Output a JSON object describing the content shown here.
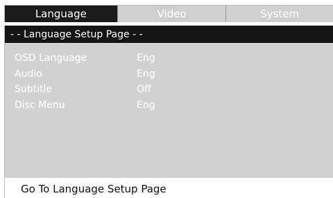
{
  "tabs": [
    {
      "label": "Language",
      "active": true
    },
    {
      "label": "Video",
      "active": false
    },
    {
      "label": "System",
      "active": false
    }
  ],
  "panel": {
    "title": "- - Language Setup Page - -"
  },
  "settings": [
    {
      "label": "OSD Language",
      "value": "Eng"
    },
    {
      "label": "Audio",
      "value": "Eng"
    },
    {
      "label": "Subtitle",
      "value": "Off"
    },
    {
      "label": "Disc Menu",
      "value": "Eng"
    }
  ],
  "footer": {
    "hint": "Go To Language Setup Page"
  },
  "colors": {
    "active_tab": "#1a1a1a",
    "inactive_tab": "#cfcfcf",
    "panel_bg": "#d2d2d2",
    "header_bg": "#151515"
  }
}
